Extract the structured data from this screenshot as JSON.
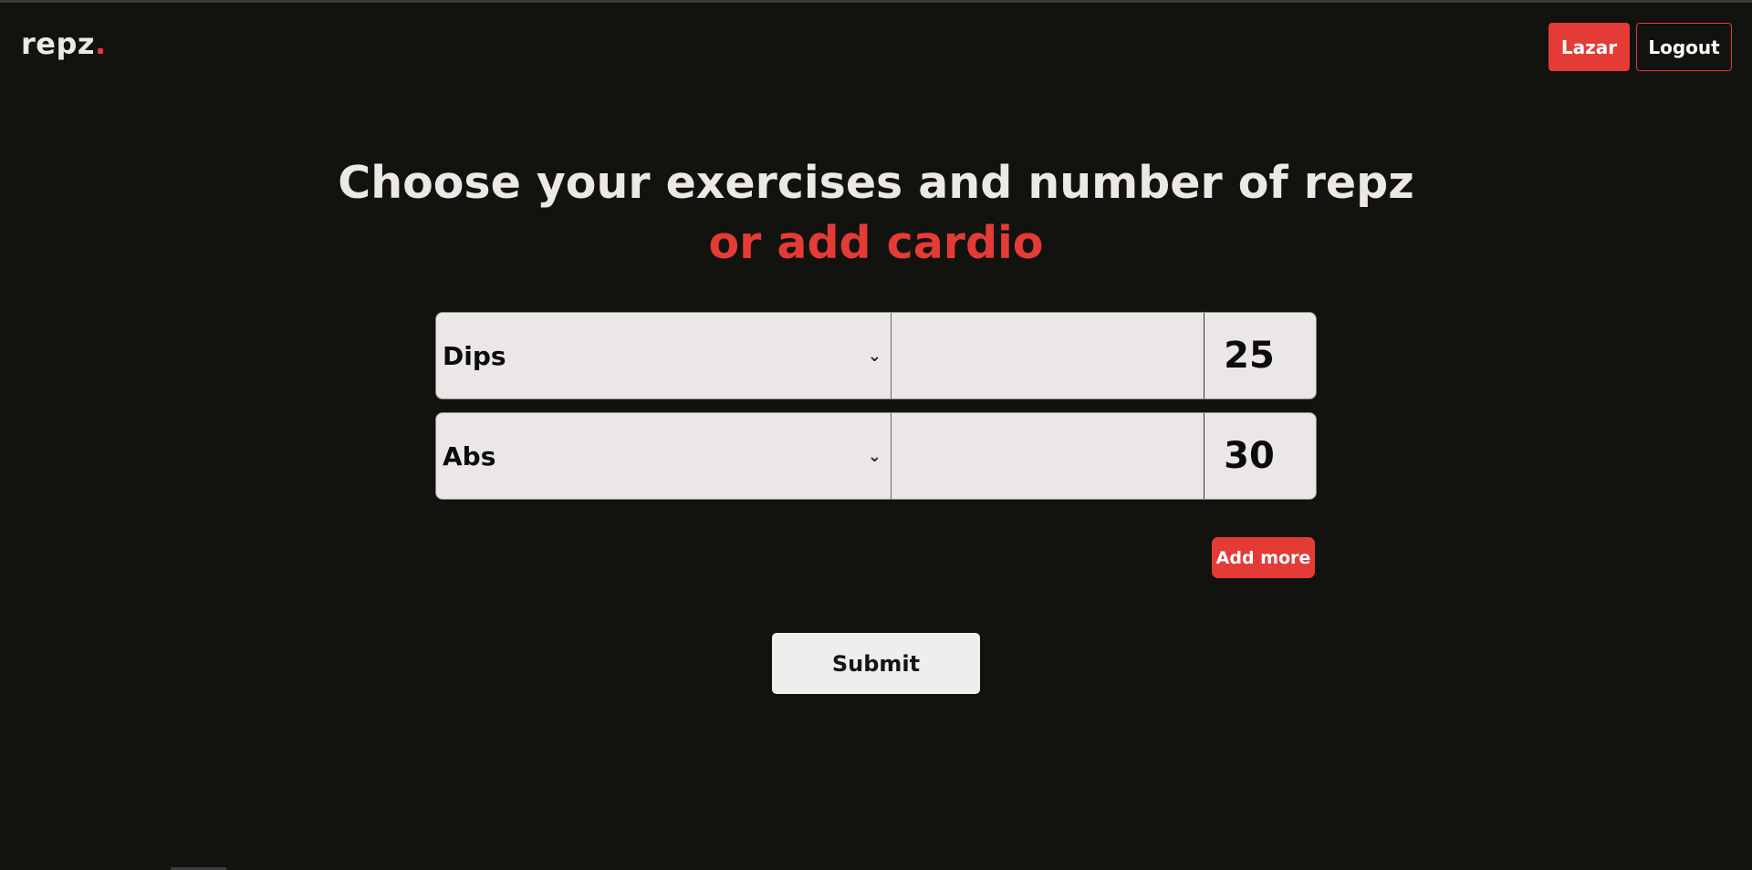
{
  "header": {
    "logo_text": "repz",
    "logo_dot": ".",
    "user_label": "Lazar",
    "logout_label": "Logout"
  },
  "main": {
    "title_line1": "Choose your exercises and number of repz",
    "title_line2": "or add cardio",
    "rows": [
      {
        "exercise": "Dips",
        "reps": "25"
      },
      {
        "exercise": "Abs",
        "reps": "30"
      }
    ],
    "add_more_label": "Add more",
    "submit_label": "Submit"
  },
  "colors": {
    "background": "#12120f",
    "accent": "#e53b36",
    "field": "#ebe7e6",
    "text_light": "#ece8e6"
  },
  "icons": {
    "dropdown": "chevron-down-icon"
  }
}
